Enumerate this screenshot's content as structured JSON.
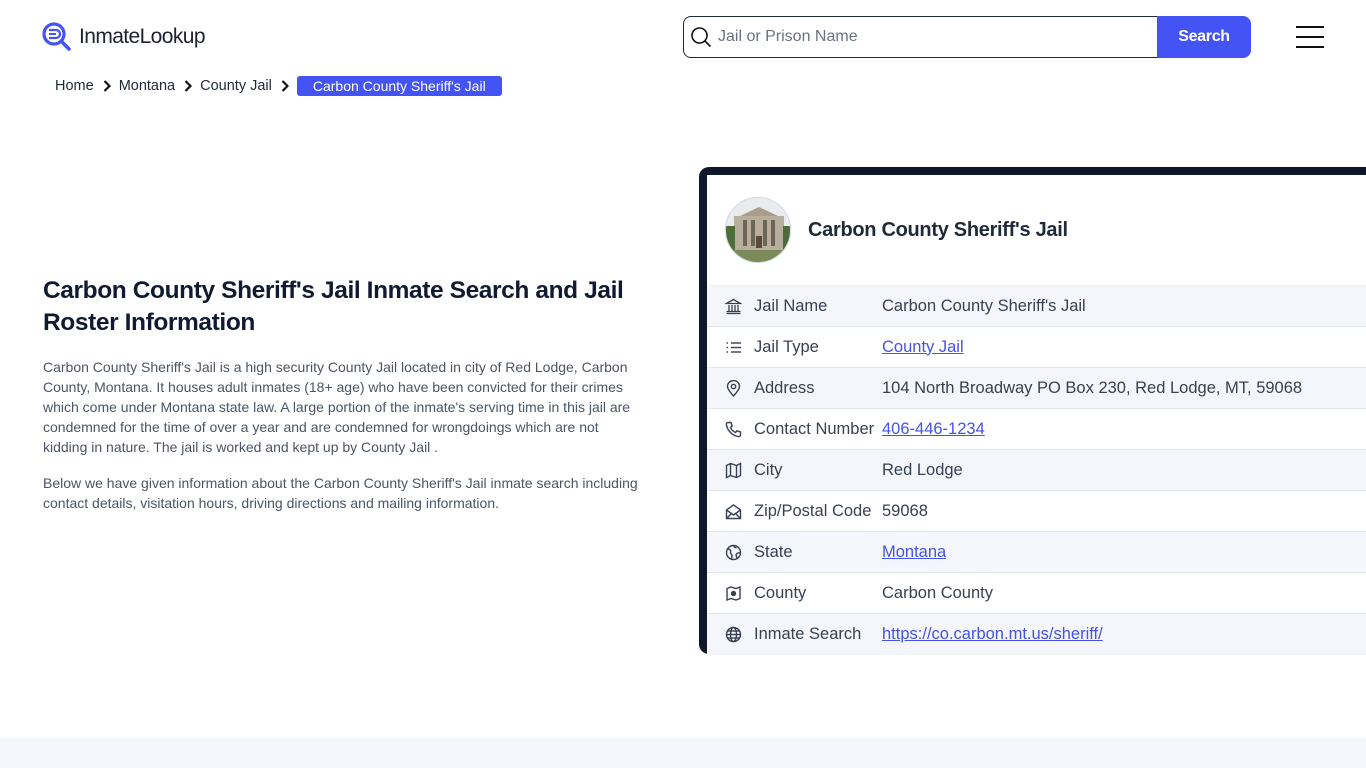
{
  "header": {
    "logo_text": "InmateLookup",
    "search_placeholder": "Jail or Prison Name",
    "search_value": "",
    "search_button": "Search",
    "menu_icon": "hamburger-menu-icon"
  },
  "breadcrumb": {
    "items": [
      {
        "label": "Home"
      },
      {
        "label": "Montana"
      },
      {
        "label": "County Jail"
      }
    ],
    "current": "Carbon County Sheriff's Jail"
  },
  "intro": {
    "title": "Carbon County Sheriff's Jail Inmate Search and Jail Roster Information",
    "paragraph1": "Carbon County Sheriff's Jail is a high security County Jail located in city of Red Lodge, Carbon County, Montana. It houses adult inmates (18+ age) who have been convicted for their crimes which come under Montana state law. A large portion of the inmate's serving time in this jail are condemned for the time of over a year and are condemned for wrongdoings which are not kidding in nature. The jail is worked and kept up by County Jail .",
    "paragraph2": "Below we have given information about the Carbon County Sheriff's Jail inmate search including contact details, visitation hours, driving directions and mailing information."
  },
  "card": {
    "title": "Carbon County Sheriff's Jail",
    "image_alt": "Carbon County Sheriff's Jail building",
    "rows": [
      {
        "icon": "bank-building-icon",
        "label": "Jail Name",
        "value": "Carbon County Sheriff's Jail",
        "link": false
      },
      {
        "icon": "list-icon",
        "label": "Jail Type",
        "value": "County Jail",
        "link": true
      },
      {
        "icon": "map-pin-icon",
        "label": "Address",
        "value": "104 North Broadway PO Box 230, Red Lodge, MT, 59068",
        "link": false
      },
      {
        "icon": "phone-icon",
        "label": "Contact Number",
        "value": "406-446-1234",
        "link": true
      },
      {
        "icon": "map-icon",
        "label": "City",
        "value": "Red Lodge",
        "link": false
      },
      {
        "icon": "mail-open-icon",
        "label": "Zip/Postal Code",
        "value": "59068",
        "link": false
      },
      {
        "icon": "globe-state-icon",
        "label": "State",
        "value": "Montana",
        "link": true
      },
      {
        "icon": "county-map-icon",
        "label": "County",
        "value": "Carbon County",
        "link": false
      },
      {
        "icon": "globe-icon",
        "label": "Inmate Search",
        "value": "https://co.carbon.mt.us/sheriff/",
        "link": true
      }
    ]
  },
  "colors": {
    "accent": "#4353f4",
    "link": "#4353e6",
    "card_border": "#0f172a",
    "heading": "#111a33",
    "row_alt": "#f5f6fb"
  }
}
